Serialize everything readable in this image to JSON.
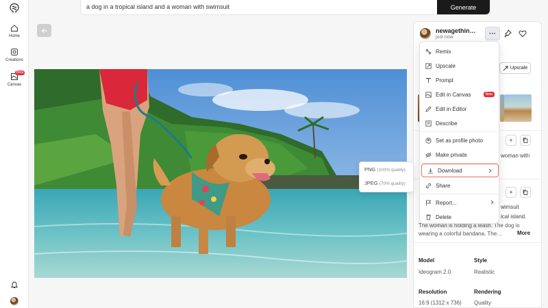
{
  "sidebar": {
    "items": [
      {
        "label": "Home",
        "icon": "home-icon"
      },
      {
        "label": "Creations",
        "icon": "creations-icon"
      },
      {
        "label": "Canvas",
        "icon": "canvas-icon",
        "badge": "Beta"
      }
    ]
  },
  "prompt": {
    "value": "a dog in a tropical island and a woman with swimsuit",
    "generate_label": "Generate"
  },
  "post": {
    "username": "newagethin…",
    "timestamp": "just now",
    "more_label": "···",
    "upscale_label": "Upscale"
  },
  "menu": {
    "items": [
      {
        "label": "Remix",
        "icon": "remix-icon"
      },
      {
        "label": "Upscale",
        "icon": "upscale-icon"
      },
      {
        "label": "Prompt",
        "icon": "prompt-icon"
      },
      {
        "label": "Edit in Canvas",
        "icon": "canvas-edit-icon",
        "badge": "Beta"
      },
      {
        "label": "Edit in Editor",
        "icon": "pencil-icon"
      },
      {
        "label": "Describe",
        "icon": "describe-icon"
      },
      {
        "label": "Set as profile photo",
        "icon": "profile-icon"
      },
      {
        "label": "Make private",
        "icon": "eye-off-icon"
      },
      {
        "label": "Download",
        "icon": "download-icon",
        "active": true
      },
      {
        "label": "Share",
        "icon": "link-icon"
      },
      {
        "label": "Report...",
        "icon": "flag-icon"
      },
      {
        "label": "Delete",
        "icon": "trash-icon"
      }
    ]
  },
  "download_submenu": [
    {
      "format": "PNG",
      "quality": "(100% quality)"
    },
    {
      "format": "JPEG",
      "quality": "(70% quality)"
    }
  ],
  "panel_fragments": {
    "woman_with": "woman with",
    "swimsuit": "wimsuit",
    "island": "ical island."
  },
  "description": {
    "line3_visible": "The woman is holding a leash. The dog is",
    "line4": "wearing a colorful bandana. The…",
    "more_label": "More"
  },
  "details": {
    "model_label": "Model",
    "model_value": "Ideogram 2.0",
    "style_label": "Style",
    "style_value": "Realistic",
    "resolution_label": "Resolution",
    "resolution_value": "16:9 (1312 x 736)",
    "rendering_label": "Rendering",
    "rendering_value": "Quality"
  },
  "colors": {
    "accent_orange": "#e8704d",
    "beta_red": "#e0323d",
    "generate_bg": "#1a1a1a"
  }
}
